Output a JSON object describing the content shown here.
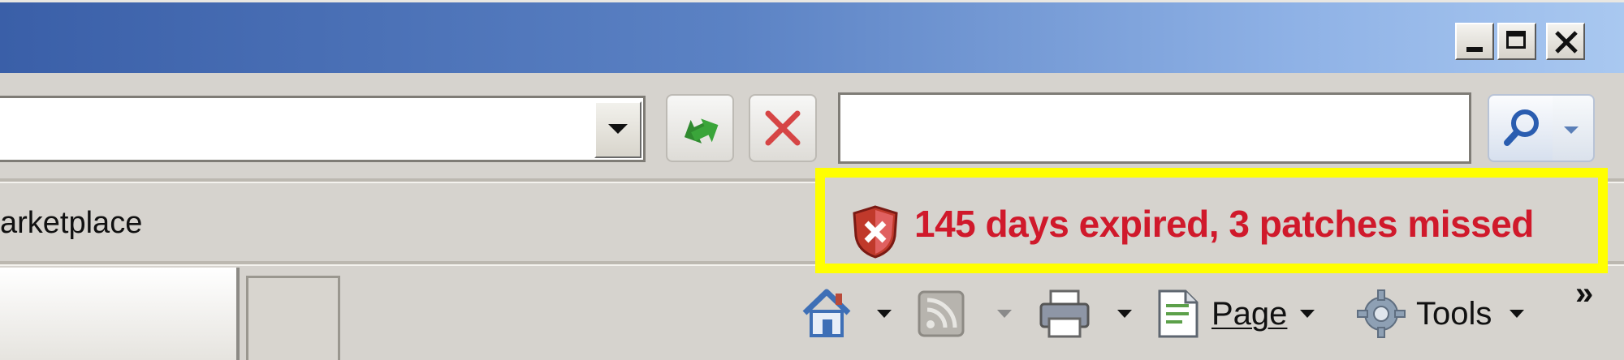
{
  "window": {
    "caption_buttons": [
      "minimize",
      "maximize",
      "close"
    ]
  },
  "address_bar": {
    "value": "",
    "refresh_icon": "refresh-icon",
    "stop_icon": "stop-icon"
  },
  "search": {
    "value": "",
    "button_icon": "search-icon"
  },
  "favorites": {
    "visible_text": "arketplace"
  },
  "alert": {
    "text": "145 days expired, 3 patches missed",
    "color": "#d0192b",
    "highlight_color": "#ffff00"
  },
  "command_bar": {
    "page_label": "Page",
    "tools_label": "Tools",
    "more": "»",
    "icons": [
      "home-icon",
      "rss-feed-icon",
      "print-icon",
      "page-icon",
      "gear-icon"
    ]
  }
}
